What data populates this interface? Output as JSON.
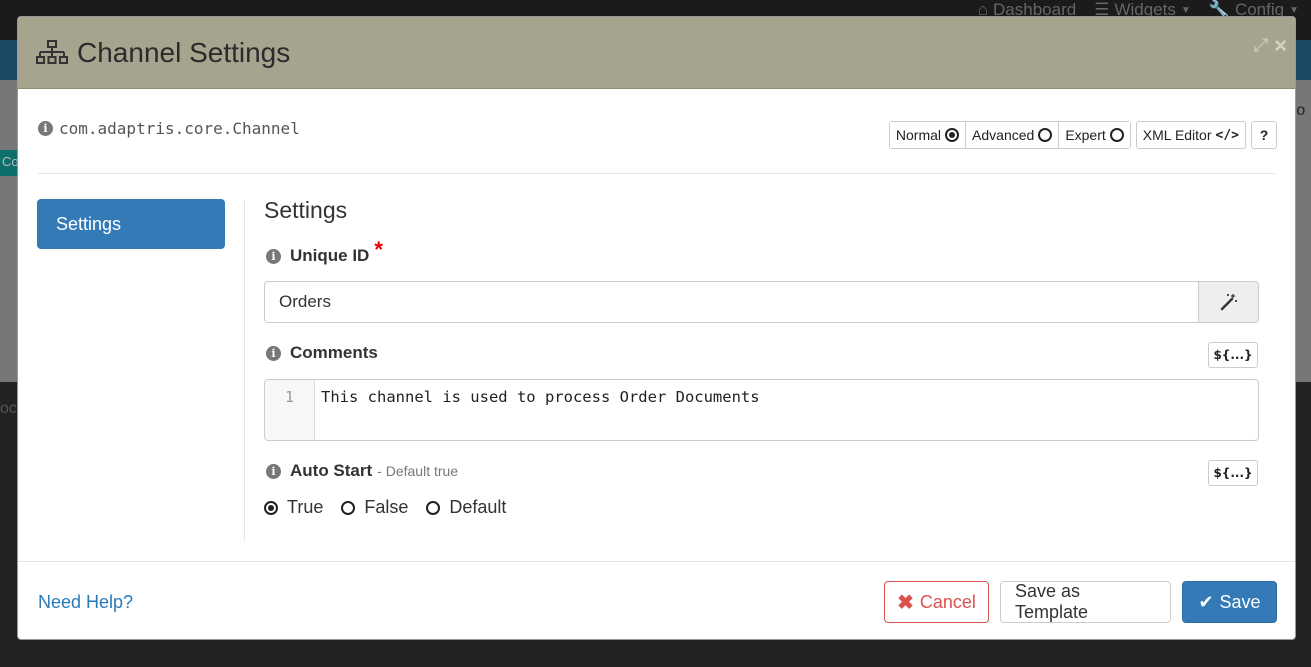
{
  "background": {
    "nav": [
      {
        "label": "Dashboard",
        "icon": "home-icon"
      },
      {
        "label": "Widgets",
        "icon": "list-icon"
      },
      {
        "label": "Config",
        "icon": "wrench-icon"
      }
    ],
    "side_tag": "Co",
    "right_fragment": "ro",
    "left_fragment": "oc"
  },
  "modal": {
    "title": "Channel Settings",
    "header_icon": "sitemap-icon",
    "class_name": "com.adaptris.core.Channel",
    "modes": [
      {
        "label": "Normal",
        "selected": true
      },
      {
        "label": "Advanced",
        "selected": false
      },
      {
        "label": "Expert",
        "selected": false
      }
    ],
    "xml_editor_label": "XML Editor",
    "help_label": "?",
    "sidebar": {
      "items": [
        {
          "label": "Settings",
          "active": true
        }
      ]
    },
    "section_title": "Settings",
    "unique_id": {
      "label": "Unique ID",
      "required_mark": "*",
      "value": "Orders"
    },
    "comments": {
      "label": "Comments",
      "expression_label": "${...}",
      "line_number": "1",
      "text": "This channel is used to process Order Documents"
    },
    "auto_start": {
      "label": "Auto Start",
      "default_note": "- Default true",
      "expression_label": "${...}",
      "options": [
        {
          "label": "True",
          "selected": true
        },
        {
          "label": "False",
          "selected": false
        },
        {
          "label": "Default",
          "selected": false
        }
      ]
    },
    "footer": {
      "help_link": "Need Help?",
      "cancel_label": "Cancel",
      "save_template_label": "Save as Template",
      "save_label": "Save"
    }
  },
  "colors": {
    "header_bg": "#a6a38e",
    "primary": "#337ab7",
    "danger": "#d9534f",
    "required": "#e00000"
  }
}
